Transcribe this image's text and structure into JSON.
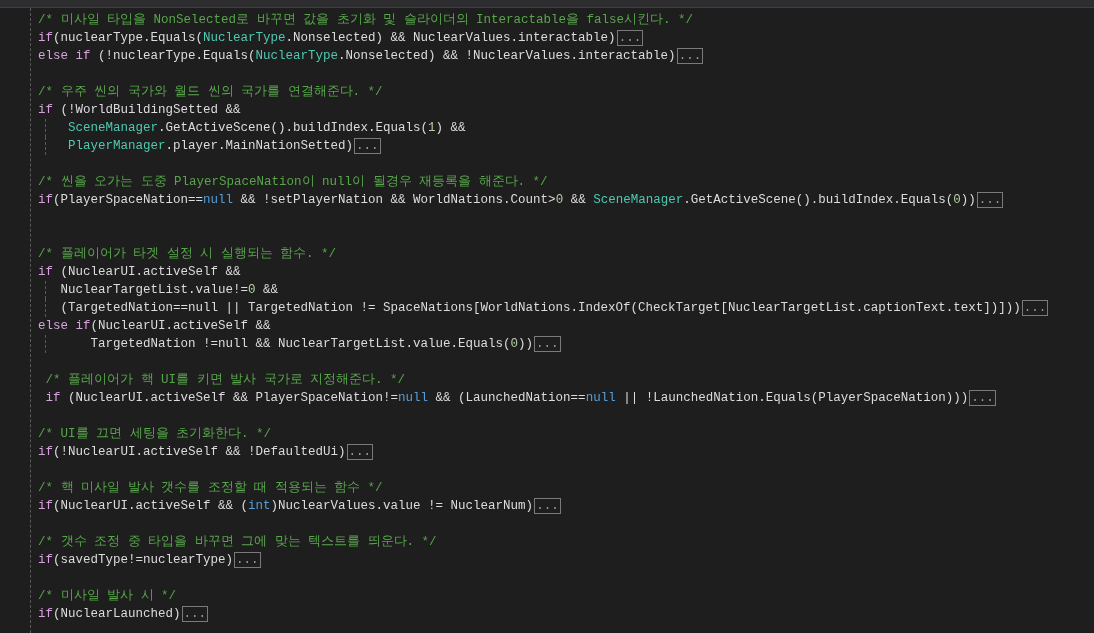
{
  "lines": [
    {
      "kind": "code",
      "guide": false,
      "tokens": [
        {
          "kind": "comment",
          "text": "/* 미사일 타입을 NonSelected로 바꾸면 값을 초기화 및 슬라이더의 Interactable을 false시킨다. */"
        }
      ]
    },
    {
      "kind": "code",
      "guide": false,
      "fold": "...",
      "tokens": [
        {
          "kind": "keyword",
          "text": "if"
        },
        {
          "kind": "plain",
          "text": "(nuclearType.Equals("
        },
        {
          "kind": "type",
          "text": "NuclearType"
        },
        {
          "kind": "plain",
          "text": ".Nonselected) && NuclearValues.interactable)"
        }
      ]
    },
    {
      "kind": "code",
      "guide": false,
      "fold": "...",
      "tokens": [
        {
          "kind": "keyword",
          "text": "else if"
        },
        {
          "kind": "plain",
          "text": " (!nuclearType.Equals("
        },
        {
          "kind": "type",
          "text": "NuclearType"
        },
        {
          "kind": "plain",
          "text": ".Nonselected) && !NuclearValues.interactable)"
        }
      ]
    },
    {
      "kind": "blank",
      "guide": false
    },
    {
      "kind": "code",
      "guide": false,
      "tokens": [
        {
          "kind": "comment",
          "text": "/* 우주 씬의 국가와 월드 씬의 국가를 연결해준다. */"
        }
      ]
    },
    {
      "kind": "code",
      "guide": false,
      "tokens": [
        {
          "kind": "keyword",
          "text": "if"
        },
        {
          "kind": "plain",
          "text": " (!WorldBuildingSetted &&"
        }
      ]
    },
    {
      "kind": "code",
      "guide": true,
      "tokens": [
        {
          "kind": "type",
          "text": "    SceneManager"
        },
        {
          "kind": "plain",
          "text": ".GetActiveScene().buildIndex.Equals("
        },
        {
          "kind": "number",
          "text": "1"
        },
        {
          "kind": "plain",
          "text": ") &&"
        }
      ]
    },
    {
      "kind": "code",
      "guide": true,
      "fold": "...",
      "tokens": [
        {
          "kind": "type",
          "text": "    PlayerManager"
        },
        {
          "kind": "plain",
          "text": ".player.MainNationSetted)"
        }
      ]
    },
    {
      "kind": "blank",
      "guide": false
    },
    {
      "kind": "code",
      "guide": false,
      "tokens": [
        {
          "kind": "comment",
          "text": "/* 씬을 오가는 도중 PlayerSpaceNation이 null이 될경우 재등록을 해준다. */"
        }
      ]
    },
    {
      "kind": "code",
      "guide": false,
      "fold": "...",
      "tokens": [
        {
          "kind": "keyword",
          "text": "if"
        },
        {
          "kind": "plain",
          "text": "(PlayerSpaceNation=="
        },
        {
          "kind": "literal",
          "text": "null"
        },
        {
          "kind": "plain",
          "text": " && !setPlayerNation && WorldNations.Count>"
        },
        {
          "kind": "number",
          "text": "0"
        },
        {
          "kind": "plain",
          "text": " && "
        },
        {
          "kind": "type",
          "text": "SceneManager"
        },
        {
          "kind": "plain",
          "text": ".GetActiveScene().buildIndex.Equals("
        },
        {
          "kind": "number",
          "text": "0"
        },
        {
          "kind": "plain",
          "text": "))"
        }
      ]
    },
    {
      "kind": "blank",
      "guide": false
    },
    {
      "kind": "blank",
      "guide": false
    },
    {
      "kind": "code",
      "guide": false,
      "tokens": [
        {
          "kind": "comment",
          "text": "/* 플레이어가 타겟 설정 시 실행되는 함수. */"
        }
      ]
    },
    {
      "kind": "code",
      "guide": false,
      "tokens": [
        {
          "kind": "keyword",
          "text": "if"
        },
        {
          "kind": "plain",
          "text": " (NuclearUI.activeSelf &&"
        }
      ]
    },
    {
      "kind": "code",
      "guide": true,
      "tokens": [
        {
          "kind": "plain",
          "text": "   NuclearTargetList.value!="
        },
        {
          "kind": "number",
          "text": "0"
        },
        {
          "kind": "plain",
          "text": " &&"
        }
      ]
    },
    {
      "kind": "code",
      "guide": true,
      "fold": "...",
      "tokens": [
        {
          "kind": "plain",
          "text": "   (TargetedNation==null || TargetedNation != SpaceNations[WorldNations.IndexOf(CheckTarget[NuclearTargetList.captionText.text])]))"
        }
      ]
    },
    {
      "kind": "code",
      "guide": false,
      "tokens": [
        {
          "kind": "keyword",
          "text": "else if"
        },
        {
          "kind": "plain",
          "text": "(NuclearUI.activeSelf &&"
        }
      ]
    },
    {
      "kind": "code",
      "guide": true,
      "fold": "...",
      "tokens": [
        {
          "kind": "plain",
          "text": "       TargetedNation !=null && NuclearTargetList.value.Equals("
        },
        {
          "kind": "number",
          "text": "0"
        },
        {
          "kind": "plain",
          "text": "))"
        }
      ]
    },
    {
      "kind": "blank",
      "guide": false
    },
    {
      "kind": "code",
      "guide": false,
      "tokens": [
        {
          "kind": "comment",
          "text": " /* 플레이어가 핵 UI를 키면 발사 국가로 지정해준다. */"
        }
      ]
    },
    {
      "kind": "code",
      "guide": false,
      "fold": "...",
      "tokens": [
        {
          "kind": "keyword",
          "text": " if"
        },
        {
          "kind": "plain",
          "text": " (NuclearUI.activeSelf && PlayerSpaceNation!="
        },
        {
          "kind": "literal",
          "text": "null"
        },
        {
          "kind": "plain",
          "text": " && (LaunchedNation=="
        },
        {
          "kind": "literal",
          "text": "null"
        },
        {
          "kind": "plain",
          "text": " || !LaunchedNation.Equals(PlayerSpaceNation)))"
        }
      ]
    },
    {
      "kind": "blank",
      "guide": false
    },
    {
      "kind": "code",
      "guide": false,
      "tokens": [
        {
          "kind": "comment",
          "text": "/* UI를 끄면 세팅을 초기화한다. */"
        }
      ]
    },
    {
      "kind": "code",
      "guide": false,
      "fold": "...",
      "tokens": [
        {
          "kind": "keyword",
          "text": "if"
        },
        {
          "kind": "plain",
          "text": "(!NuclearUI.activeSelf && !DefaultedUi)"
        }
      ]
    },
    {
      "kind": "blank",
      "guide": false
    },
    {
      "kind": "code",
      "guide": false,
      "tokens": [
        {
          "kind": "comment",
          "text": "/* 핵 미사일 발사 갯수를 조정할 때 적용되는 함수 */"
        }
      ]
    },
    {
      "kind": "code",
      "guide": false,
      "fold": "...",
      "tokens": [
        {
          "kind": "keyword",
          "text": "if"
        },
        {
          "kind": "plain",
          "text": "(NuclearUI.activeSelf && ("
        },
        {
          "kind": "literal",
          "text": "int"
        },
        {
          "kind": "plain",
          "text": ")NuclearValues.value != NuclearNum)"
        }
      ]
    },
    {
      "kind": "blank",
      "guide": false
    },
    {
      "kind": "code",
      "guide": false,
      "tokens": [
        {
          "kind": "comment",
          "text": "/* 갯수 조정 중 타입을 바꾸면 그에 맞는 텍스트를 띄운다. */"
        }
      ]
    },
    {
      "kind": "code",
      "guide": false,
      "fold": "...",
      "tokens": [
        {
          "kind": "keyword",
          "text": "if"
        },
        {
          "kind": "plain",
          "text": "(savedType!=nuclearType)"
        }
      ]
    },
    {
      "kind": "blank",
      "guide": false
    },
    {
      "kind": "code",
      "guide": false,
      "tokens": [
        {
          "kind": "comment",
          "text": "/* 미사일 발사 시 */"
        }
      ]
    },
    {
      "kind": "code",
      "guide": false,
      "fold": "...",
      "tokens": [
        {
          "kind": "keyword",
          "text": "if"
        },
        {
          "kind": "plain",
          "text": "(NuclearLaunched)"
        }
      ]
    }
  ]
}
